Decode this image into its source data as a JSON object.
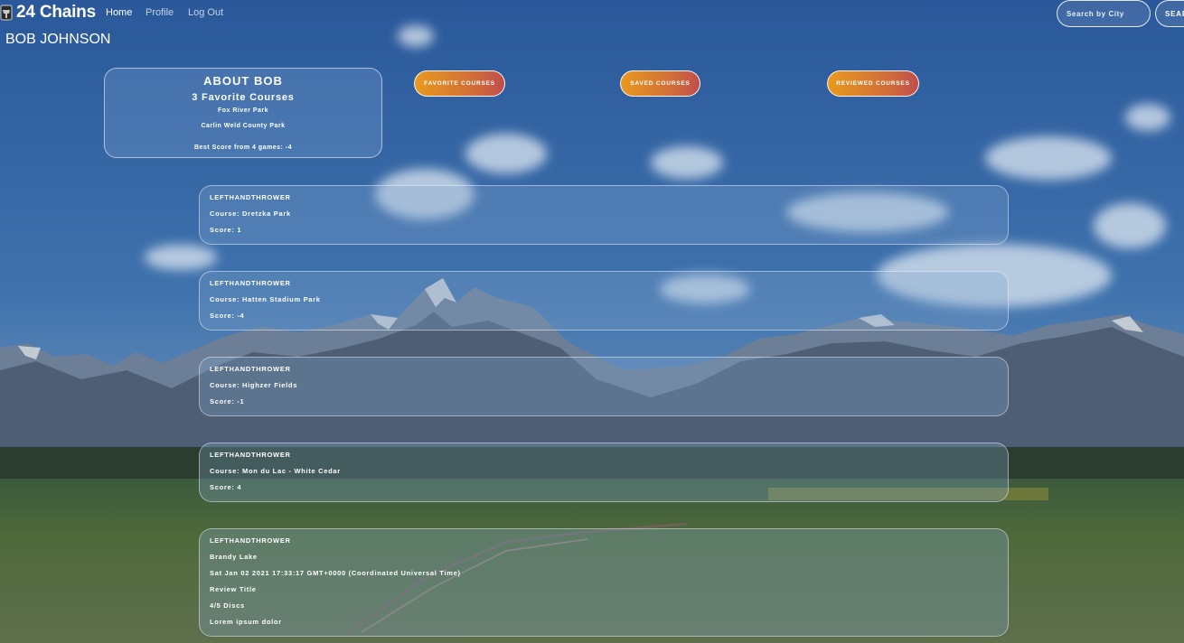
{
  "navbar": {
    "brand": "24 Chains",
    "links": [
      "Home",
      "Profile",
      "Log Out"
    ],
    "search_placeholder": "Search by City",
    "search_button": "SEARCH"
  },
  "profile": {
    "user_name": "BOB JOHNSON",
    "about": {
      "title": "ABOUT BOB",
      "favorite_count_label": "3 Favorite Courses",
      "favorite_courses": [
        "Fox River Park",
        "Carlin Weld County Park"
      ],
      "best_score": "Best Score from 4 games: -4"
    },
    "buttons": {
      "favorite": "FAVORITE COURSES",
      "saved": "SAVED COURSES",
      "reviewed": "REVIEWED COURSES"
    }
  },
  "scores": [
    {
      "user": "LEFTHANDTHROWER",
      "course": "Course: Dretzka Park",
      "score": "Score: 1"
    },
    {
      "user": "LEFTHANDTHROWER",
      "course": "Course: Hatten Stadium Park",
      "score": "Score: -4"
    },
    {
      "user": "LEFTHANDTHROWER",
      "course": "Course: Highzer Fields",
      "score": "Score: -1"
    },
    {
      "user": "LEFTHANDTHROWER",
      "course": "Course: Mon du Lac - White Cedar",
      "score": "Score: 4"
    }
  ],
  "review": {
    "user": "LEFTHANDTHROWER",
    "course": "Brandy Lake",
    "date": "Sat Jan 02 2021 17:33:17 GMT+0000 (Coordinated Universal Time)",
    "title": "Review Title",
    "rating": "4/5 Discs",
    "body": "Lorem ipsum dolor"
  },
  "colors": {
    "button_gradient_start": "#e89a1e",
    "button_gradient_end": "#bf4d4d",
    "sky": "#2e5c93"
  }
}
